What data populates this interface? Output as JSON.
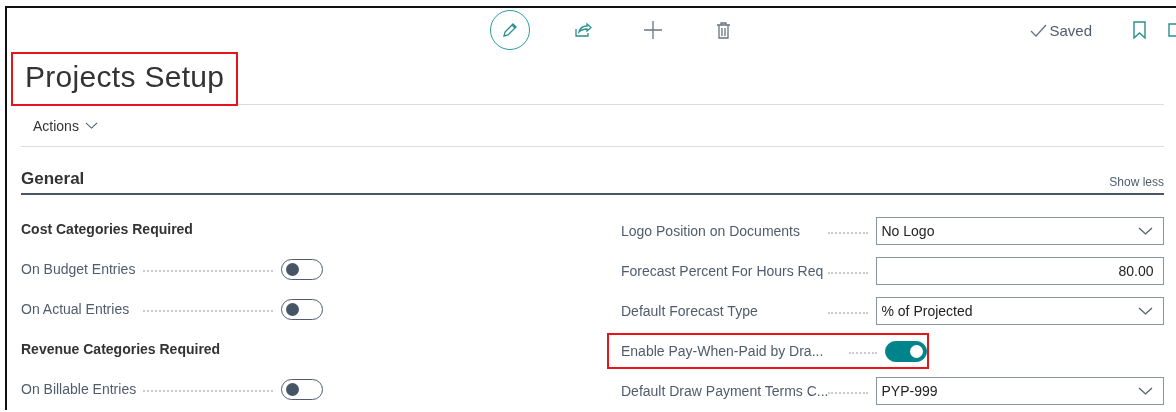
{
  "toolbar": {
    "status": "Saved"
  },
  "page": {
    "title": "Projects Setup",
    "title_highlighted": true,
    "actions_label": "Actions"
  },
  "section": {
    "title": "General",
    "toggle_label": "Show less"
  },
  "left_fields": [
    {
      "kind": "heading",
      "label": "Cost Categories Required"
    },
    {
      "kind": "toggle",
      "label": "On Budget Entries",
      "on": false
    },
    {
      "kind": "toggle",
      "label": "On Actual Entries",
      "on": false
    },
    {
      "kind": "heading",
      "label": "Revenue Categories Required"
    },
    {
      "kind": "toggle",
      "label": "On Billable Entries",
      "on": false
    }
  ],
  "right_fields": [
    {
      "kind": "select",
      "label": "Logo Position on Documents",
      "value": "No Logo",
      "highlighted": false
    },
    {
      "kind": "number",
      "label": "Forecast Percent For Hours Req",
      "value": "80.00",
      "highlighted": false
    },
    {
      "kind": "select",
      "label": "Default Forecast Type",
      "value": "% of Projected",
      "highlighted": false
    },
    {
      "kind": "toggle",
      "label": "Enable Pay-When-Paid by Dra...",
      "on": true,
      "highlighted": true
    },
    {
      "kind": "select",
      "label": "Default Draw Payment Terms C...",
      "value": "PYP-999",
      "highlighted": false
    }
  ]
}
